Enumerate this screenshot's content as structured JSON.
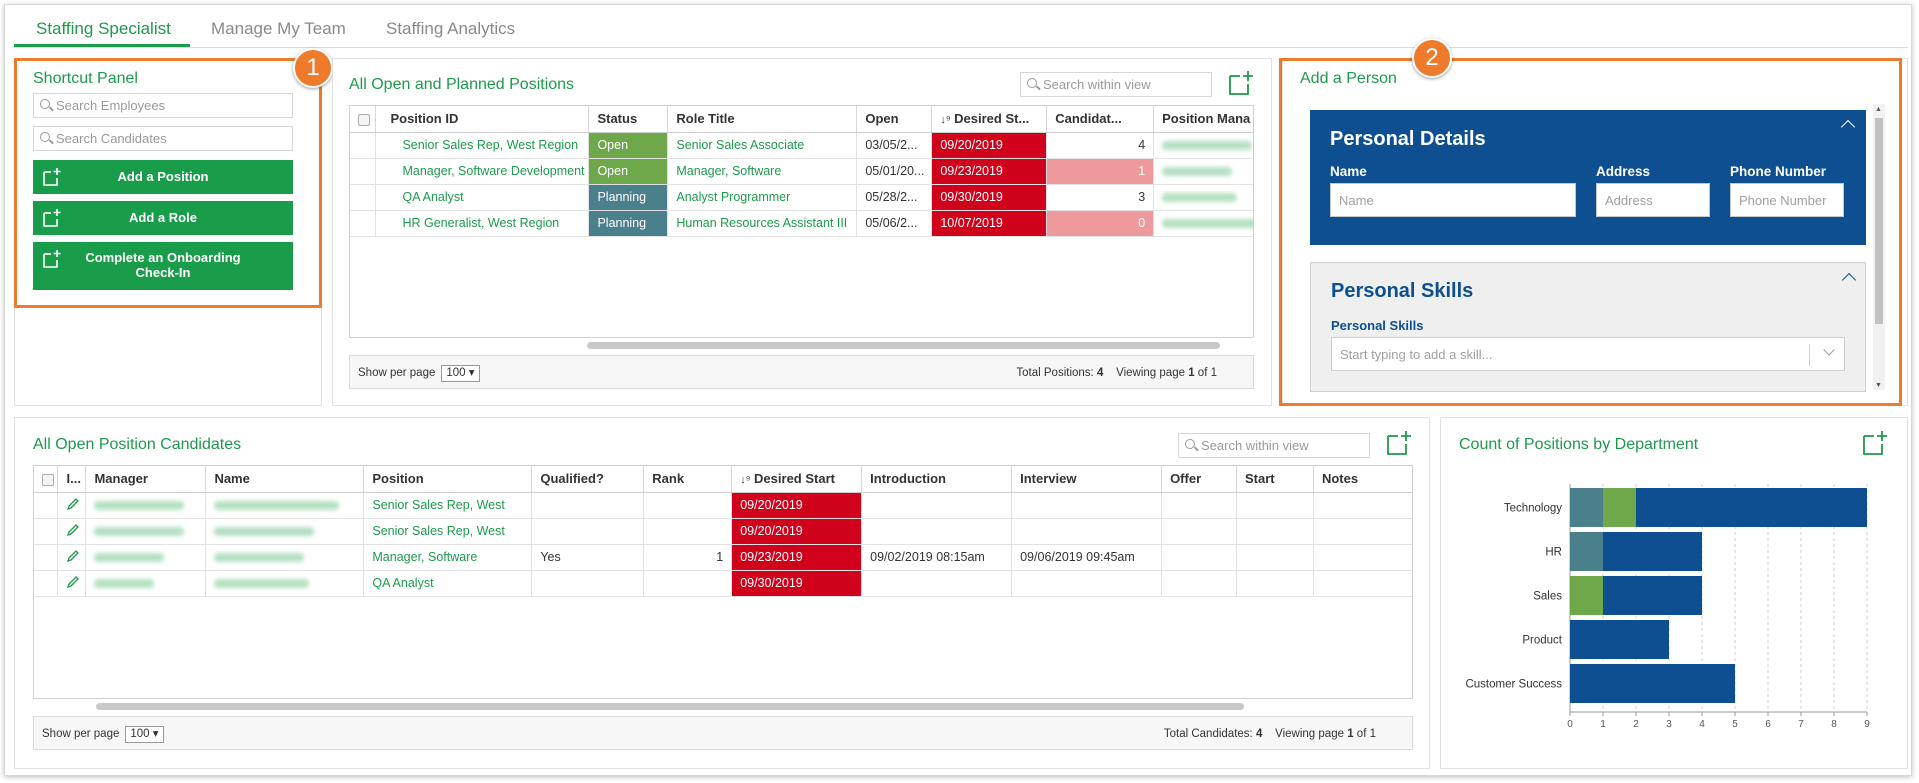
{
  "tabs": [
    {
      "label": "Staffing Specialist",
      "active": true
    },
    {
      "label": "Manage My Team",
      "active": false
    },
    {
      "label": "Staffing Analytics",
      "active": false
    }
  ],
  "badges": [
    "1",
    "2"
  ],
  "shortcut_panel": {
    "title": "Shortcut Panel",
    "search_employees_placeholder": "Search Employees",
    "search_candidates_placeholder": "Search Candidates",
    "buttons": [
      "Add a Position",
      "Add a Role",
      "Complete an Onboarding Check-In"
    ]
  },
  "positions": {
    "title": "All Open and Planned Positions",
    "search_placeholder": "Search within view",
    "columns": [
      "Position ID",
      "Status",
      "Role Title",
      "Open",
      "Desired St...",
      "Candidat...",
      "Position Mana"
    ],
    "rows": [
      {
        "position_id": "Senior Sales Rep, West Region",
        "status": "Open",
        "role": "Senior Sales Associate",
        "open": "03/05/2...",
        "desired": "09/20/2019",
        "candidates": "4"
      },
      {
        "position_id": "Manager, Software Development",
        "status": "Open",
        "role": "Manager, Software",
        "open": "05/01/20...",
        "desired": "09/23/2019",
        "candidates": "1"
      },
      {
        "position_id": "QA Analyst",
        "status": "Planning",
        "role": "Analyst Programmer",
        "open": "05/28/2...",
        "desired": "09/30/2019",
        "candidates": "3"
      },
      {
        "position_id": "HR Generalist, West Region",
        "status": "Planning",
        "role": "Human Resources Assistant III",
        "open": "05/06/2...",
        "desired": "10/07/2019",
        "candidates": "0"
      }
    ],
    "footer": {
      "show_per_page_label": "Show per page",
      "per_page": "100",
      "total_label": "Total Positions:",
      "total": "4",
      "viewing_label": "Viewing page",
      "page": "1",
      "of_label": "of",
      "pages": "1"
    }
  },
  "add_person": {
    "title": "Add a Person",
    "personal_details": {
      "heading": "Personal Details",
      "name_label": "Name",
      "name_placeholder": "Name",
      "address_label": "Address",
      "address_placeholder": "Address",
      "phone_label": "Phone Number",
      "phone_placeholder": "Phone Number"
    },
    "personal_skills": {
      "heading": "Personal Skills",
      "label": "Personal Skills",
      "placeholder": "Start typing to add a skill..."
    }
  },
  "candidates": {
    "title": "All Open Position Candidates",
    "search_placeholder": "Search within view",
    "columns": [
      "I...",
      "Manager",
      "Name",
      "Position",
      "Qualified?",
      "Rank",
      "Desired Start",
      "Introduction",
      "Interview",
      "Offer",
      "Start",
      "Notes"
    ],
    "rows": [
      {
        "position": "Senior Sales Rep, West",
        "qualified": "",
        "rank": "",
        "desired": "09/20/2019",
        "introduction": "",
        "interview": ""
      },
      {
        "position": "Senior Sales Rep, West",
        "qualified": "",
        "rank": "",
        "desired": "09/20/2019",
        "introduction": "",
        "interview": ""
      },
      {
        "position": "Manager, Software",
        "qualified": "Yes",
        "rank": "1",
        "desired": "09/23/2019",
        "introduction": "09/02/2019 08:15am",
        "interview": "09/06/2019 09:45am"
      },
      {
        "position": "QA Analyst",
        "qualified": "",
        "rank": "",
        "desired": "09/30/2019",
        "introduction": "",
        "interview": ""
      }
    ],
    "footer": {
      "show_per_page_label": "Show per page",
      "per_page": "100",
      "total_label": "Total Candidates:",
      "total": "4",
      "viewing_label": "Viewing page",
      "page": "1",
      "of_label": "of",
      "pages": "1"
    }
  },
  "dept_chart": {
    "title": "Count of Positions by Department"
  },
  "chart_data": {
    "type": "bar",
    "orientation": "horizontal",
    "stacked": true,
    "categories": [
      "Technology",
      "HR",
      "Sales",
      "Product",
      "Customer Success"
    ],
    "series": [
      {
        "values": [
          1,
          1,
          0,
          0,
          0
        ],
        "color": "#4a7f8c"
      },
      {
        "values": [
          1,
          0,
          1,
          0,
          0
        ],
        "color": "#6ea84a"
      },
      {
        "values": [
          7,
          3,
          3,
          3,
          5
        ],
        "color": "#0e4f92"
      }
    ],
    "xlim": [
      0,
      9
    ],
    "xticks": [
      0,
      1,
      2,
      3,
      4,
      5,
      6,
      7,
      8,
      9
    ],
    "grid": "vertical dashed"
  },
  "colors": {
    "accent": "#1d9a4c",
    "highlight": "#ee7a2c",
    "navy": "#0e4f92",
    "alert": "#d0021b"
  }
}
